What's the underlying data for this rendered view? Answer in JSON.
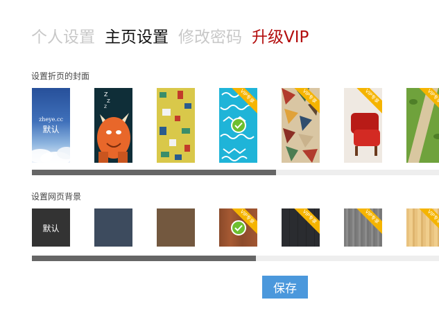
{
  "tabs": [
    {
      "label": "个人设置"
    },
    {
      "label": "主页设置"
    },
    {
      "label": "修改密码"
    },
    {
      "label": "升级VIP"
    }
  ],
  "cover": {
    "label": "设置折页的封面",
    "default_label": "默认",
    "site_text": "zheye.cc",
    "vip_badge": "VIP专享",
    "selected_index": 3,
    "scroll_position": 0.6
  },
  "background": {
    "label": "设置网页背景",
    "default_label": "默认",
    "vip_badge": "VIP专享",
    "selected_index": 3,
    "scroll_position": 0.55
  },
  "save_label": "保存",
  "colors": {
    "vip": "#b30d0d",
    "save": "#4b98dc",
    "check": "#6dbf2f",
    "ribbon": "#f5b400"
  }
}
